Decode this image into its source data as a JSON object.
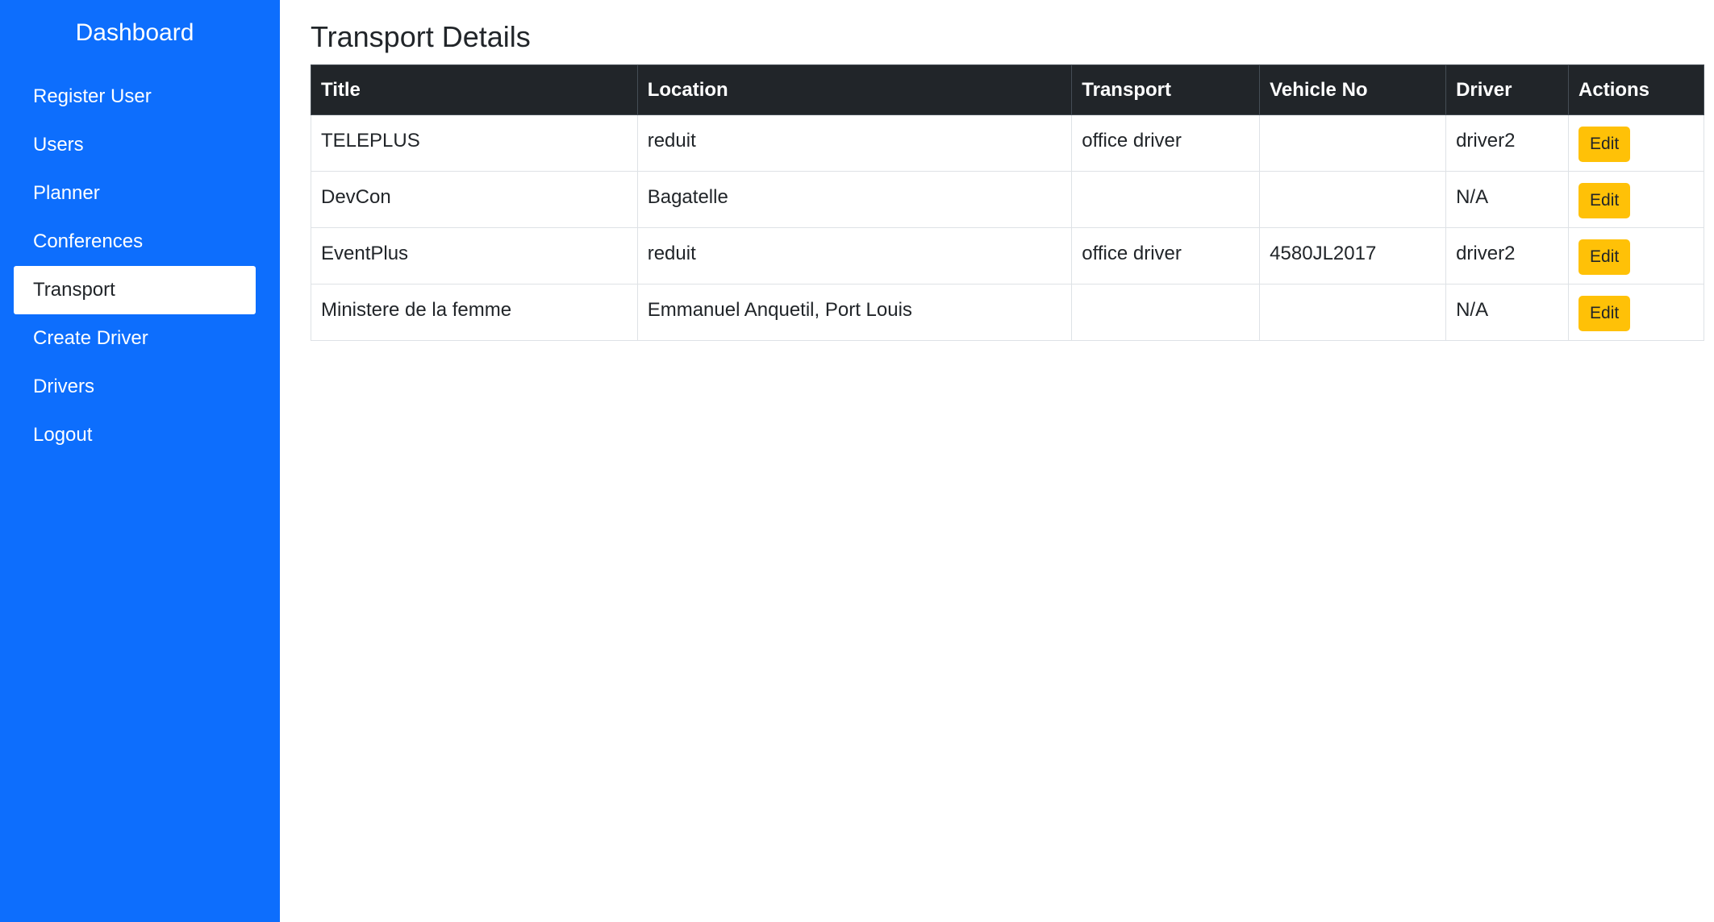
{
  "sidebar": {
    "brand": "Dashboard",
    "items": [
      {
        "label": "Register User"
      },
      {
        "label": "Users"
      },
      {
        "label": "Planner"
      },
      {
        "label": "Conferences"
      },
      {
        "label": "Transport"
      },
      {
        "label": "Create Driver"
      },
      {
        "label": "Drivers"
      },
      {
        "label": "Logout"
      }
    ],
    "active_item": "Transport"
  },
  "main": {
    "title": "Transport Details",
    "table": {
      "headers": [
        "Title",
        "Location",
        "Transport",
        "Vehicle No",
        "Driver",
        "Actions"
      ],
      "rows": [
        {
          "title": "TELEPLUS",
          "location": "reduit",
          "transport": "office driver",
          "vehicle_no": "",
          "driver": "driver2",
          "action": "Edit"
        },
        {
          "title": "DevCon",
          "location": "Bagatelle",
          "transport": "",
          "vehicle_no": "",
          "driver": "N/A",
          "action": "Edit"
        },
        {
          "title": "EventPlus",
          "location": "reduit",
          "transport": "office driver",
          "vehicle_no": "4580JL2017",
          "driver": "driver2",
          "action": "Edit"
        },
        {
          "title": "Ministere de la femme",
          "location": "Emmanuel Anquetil, Port Louis",
          "transport": "",
          "vehicle_no": "",
          "driver": "N/A",
          "action": "Edit"
        }
      ]
    }
  },
  "colors": {
    "sidebar_bg": "#0d6efd",
    "table_header_bg": "#212529",
    "edit_button": "#ffc107"
  }
}
